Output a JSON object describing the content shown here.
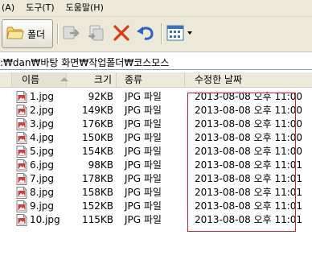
{
  "menu": {
    "items": [
      "(A)",
      "도구(T)",
      "도움말(H)"
    ]
  },
  "toolbar": {
    "folders_label": "폴더",
    "icons": [
      "folder-icon",
      "move-to-icon",
      "copy-to-icon",
      "delete-icon",
      "undo-icon",
      "views-icon"
    ]
  },
  "address": {
    "path": ":₩dan₩바탕 화면₩작업폴더₩코스모스"
  },
  "list": {
    "headers": {
      "name": "이름",
      "size": "크기",
      "type": "종류",
      "date": "수정한 날짜"
    },
    "sort_column": "name",
    "sort_direction": "ascending",
    "rows": [
      {
        "name": "1.jpg",
        "size": "92KB",
        "type": "JPG 파일",
        "date": "2013-08-08 오후 11:00"
      },
      {
        "name": "2.jpg",
        "size": "149KB",
        "type": "JPG 파일",
        "date": "2013-08-08 오후 11:00"
      },
      {
        "name": "3.jpg",
        "size": "176KB",
        "type": "JPG 파일",
        "date": "2013-08-08 오후 11:00"
      },
      {
        "name": "4.jpg",
        "size": "150KB",
        "type": "JPG 파일",
        "date": "2013-08-08 오후 11:00"
      },
      {
        "name": "5.jpg",
        "size": "154KB",
        "type": "JPG 파일",
        "date": "2013-08-08 오후 11:00"
      },
      {
        "name": "6.jpg",
        "size": "98KB",
        "type": "JPG 파일",
        "date": "2013-08-08 오후 11:01"
      },
      {
        "name": "7.jpg",
        "size": "178KB",
        "type": "JPG 파일",
        "date": "2013-08-08 오후 11:01"
      },
      {
        "name": "8.jpg",
        "size": "158KB",
        "type": "JPG 파일",
        "date": "2013-08-08 오후 11:01"
      },
      {
        "name": "9.jpg",
        "size": "152KB",
        "type": "JPG 파일",
        "date": "2013-08-08 오후 11:01"
      },
      {
        "name": "10.jpg",
        "size": "115KB",
        "type": "JPG 파일",
        "date": "2013-08-08 오후 11:01"
      }
    ]
  },
  "colors": {
    "highlight": "#e02020",
    "chrome": "#ece9d8",
    "address_border": "#7f9db9"
  }
}
